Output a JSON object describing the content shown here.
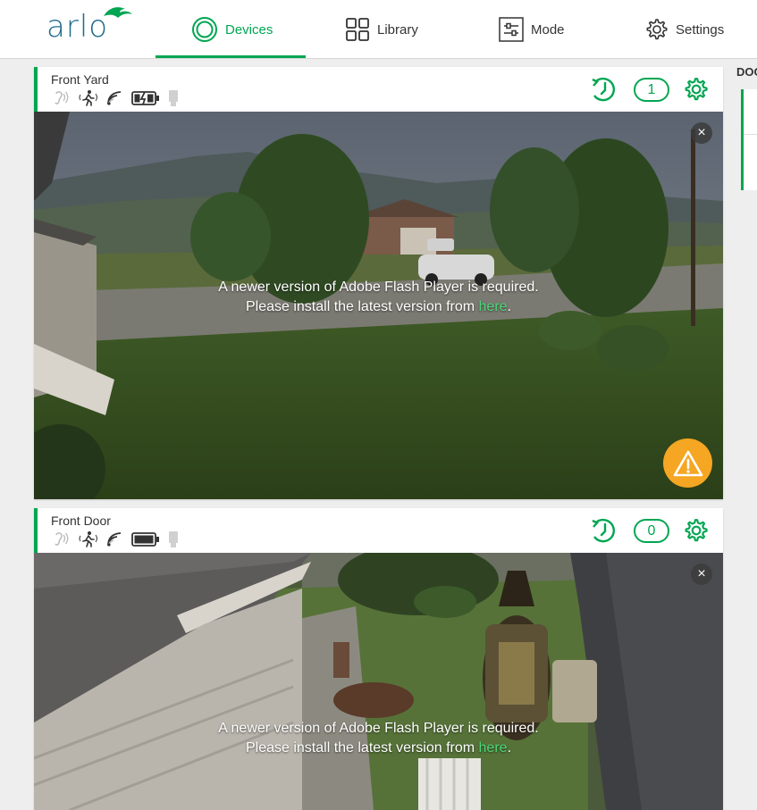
{
  "brand": {
    "logo_text": "arlo"
  },
  "nav": {
    "devices": "Devices",
    "library": "Library",
    "mode": "Mode",
    "settings": "Settings"
  },
  "side_panel": {
    "label": "DOO"
  },
  "colors": {
    "accent": "#00a651",
    "warning": "#f5a623",
    "link": "#4cd77a"
  },
  "cameras": [
    {
      "name": "Front Yard",
      "event_count": "1",
      "battery": "charging",
      "message_line1": "A newer version of Adobe Flash Player is required.",
      "message_line2_prefix": "Please install the latest version from ",
      "message_link": "here",
      "message_line2_suffix": ".",
      "icons": [
        "audio-icon",
        "motion-icon",
        "signal-icon",
        "battery-charging-icon",
        "plug-icon"
      ]
    },
    {
      "name": "Front Door",
      "event_count": "0",
      "battery": "full",
      "message_line1": "A newer version of Adobe Flash Player is required.",
      "message_line2_prefix": "Please install the latest version from ",
      "message_link": "here",
      "message_line2_suffix": ".",
      "icons": [
        "audio-icon",
        "motion-icon",
        "signal-icon",
        "battery-full-icon",
        "plug-icon"
      ]
    }
  ],
  "close_glyph": "×"
}
